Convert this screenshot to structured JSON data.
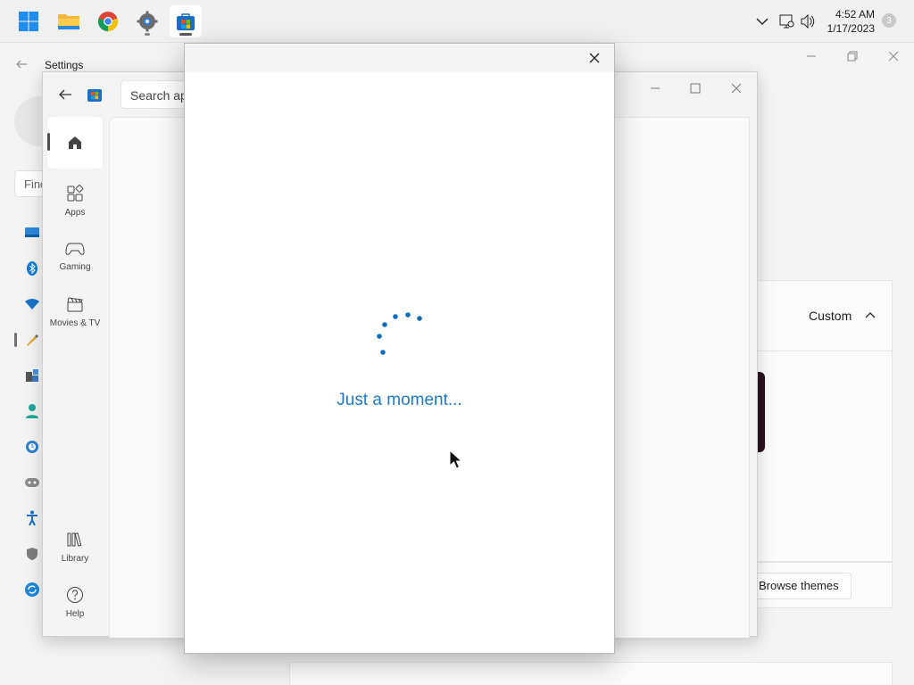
{
  "taskbar": {
    "pinned": [
      {
        "name": "start-icon",
        "label": "Start"
      },
      {
        "name": "file-explorer-icon",
        "label": "File Explorer"
      },
      {
        "name": "chrome-icon",
        "label": "Google Chrome"
      },
      {
        "name": "settings-icon",
        "label": "Settings"
      },
      {
        "name": "store-icon",
        "label": "Microsoft Store"
      }
    ],
    "clock_time": "4:52 AM",
    "clock_date": "1/17/2023",
    "notification_count": "3"
  },
  "settings_window": {
    "title": "Settings",
    "search_placeholder": "Find",
    "custom_label": "Custom",
    "browse_themes_label": "Browse themes"
  },
  "store_window": {
    "search_placeholder": "Search apps",
    "nav": [
      {
        "name": "home",
        "label": ""
      },
      {
        "name": "apps",
        "label": "Apps"
      },
      {
        "name": "gaming",
        "label": "Gaming"
      },
      {
        "name": "movies-tv",
        "label": "Movies & TV"
      },
      {
        "name": "library",
        "label": "Library"
      },
      {
        "name": "help",
        "label": "Help"
      }
    ]
  },
  "dialog": {
    "loading_text": "Just a moment..."
  },
  "colors": {
    "accent": "#1f78c1",
    "windows_blue": "#0078d4",
    "taskbar_bg": "#f0f0f0"
  }
}
